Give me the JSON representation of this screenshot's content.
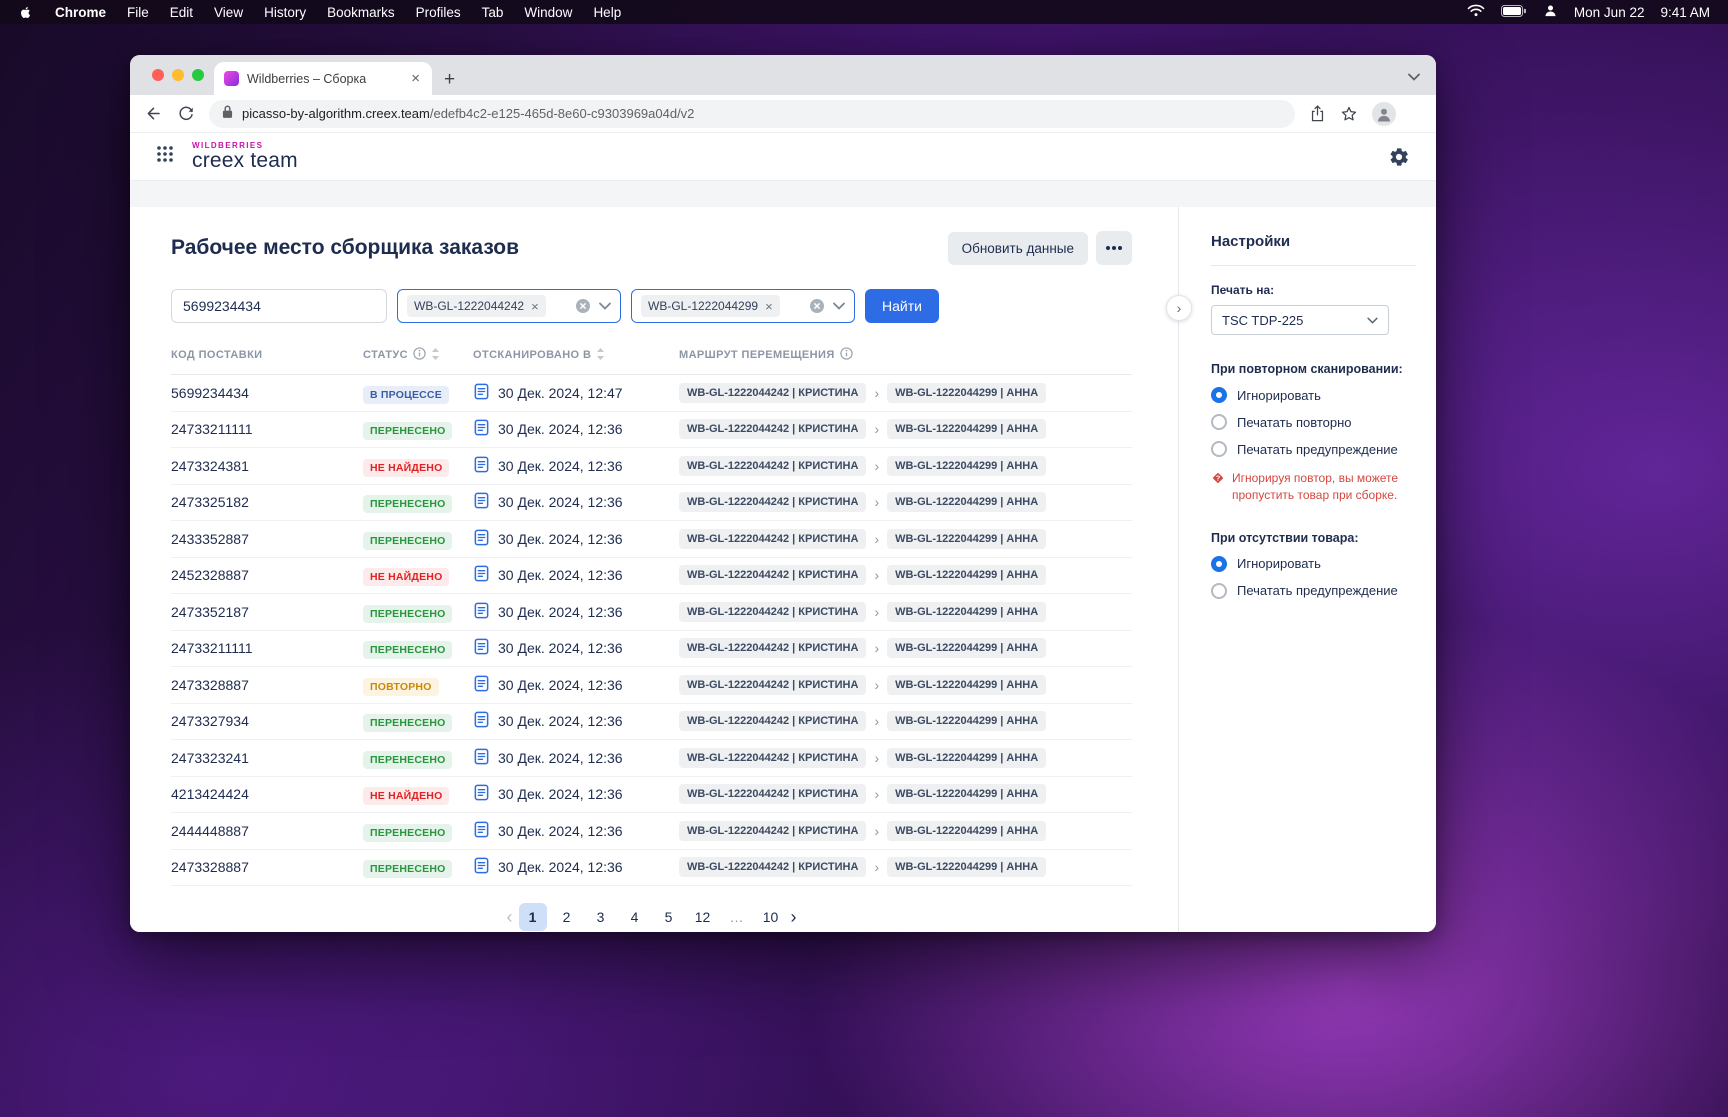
{
  "menubar": {
    "items": [
      "Chrome",
      "File",
      "Edit",
      "View",
      "History",
      "Bookmarks",
      "Profiles",
      "Tab",
      "Window",
      "Help"
    ],
    "date": "Mon Jun 22",
    "time": "9:41 AM"
  },
  "browser": {
    "tab_title": "Wildberries – Сборка",
    "new_tab": "+",
    "url_host": "picasso-by-algorithm.creex.team",
    "url_path": "/edefb4c2-e125-465d-8e60-c9303969a04d/v2"
  },
  "brand": {
    "top": "WILDBERRIES",
    "name": "creex team",
    "color": "#cb11ab"
  },
  "page": {
    "title": "Рабочее место сборщика заказов",
    "refresh_button": "Обновить данные",
    "find_button": "Найти",
    "search_value": "5699234434",
    "accent_color": "#2d6ce5"
  },
  "filters": [
    {
      "label": "WB-GL-1222044242"
    },
    {
      "label": "WB-GL-1222044299"
    }
  ],
  "table": {
    "headers": [
      "КОД ПОСТАВКИ",
      "СТАТУС",
      "ОТСКАНИРОВАНО В",
      "МАРШРУТ ПЕРЕМЕЩЕНИЯ"
    ],
    "status_colors": {
      "inprogress": {
        "bg": "#e8eef8",
        "fg": "#3b5bab"
      },
      "moved": {
        "bg": "#e5f3ea",
        "fg": "#27963c"
      },
      "notfound": {
        "bg": "#fdeaea",
        "fg": "#e02424"
      },
      "repeat": {
        "bg": "#fdf3e1",
        "fg": "#c98a0b"
      }
    },
    "rows": [
      {
        "code": "5699234434",
        "status": "В ПРОЦЕССЕ",
        "status_type": "inprogress",
        "scanned": "30 Дек. 2024, 12:47",
        "from": "WB-GL-1222044242 | КРИСТИНА",
        "to": "WB-GL-1222044299 | АННА"
      },
      {
        "code": "24733211111",
        "status": "ПЕРЕНЕСЕНО",
        "status_type": "moved",
        "scanned": "30 Дек. 2024, 12:36",
        "from": "WB-GL-1222044242 | КРИСТИНА",
        "to": "WB-GL-1222044299 | АННА"
      },
      {
        "code": "2473324381",
        "status": "НЕ НАЙДЕНО",
        "status_type": "notfound",
        "scanned": "30 Дек. 2024, 12:36",
        "from": "WB-GL-1222044242 | КРИСТИНА",
        "to": "WB-GL-1222044299 | АННА"
      },
      {
        "code": "2473325182",
        "status": "ПЕРЕНЕСЕНО",
        "status_type": "moved",
        "scanned": "30 Дек. 2024, 12:36",
        "from": "WB-GL-1222044242 | КРИСТИНА",
        "to": "WB-GL-1222044299 | АННА"
      },
      {
        "code": "2433352887",
        "status": "ПЕРЕНЕСЕНО",
        "status_type": "moved",
        "scanned": "30 Дек. 2024, 12:36",
        "from": "WB-GL-1222044242 | КРИСТИНА",
        "to": "WB-GL-1222044299 | АННА"
      },
      {
        "code": "2452328887",
        "status": "НЕ НАЙДЕНО",
        "status_type": "notfound",
        "scanned": "30 Дек. 2024, 12:36",
        "from": "WB-GL-1222044242 | КРИСТИНА",
        "to": "WB-GL-1222044299 | АННА"
      },
      {
        "code": "2473352187",
        "status": "ПЕРЕНЕСЕНО",
        "status_type": "moved",
        "scanned": "30 Дек. 2024, 12:36",
        "from": "WB-GL-1222044242 | КРИСТИНА",
        "to": "WB-GL-1222044299 | АННА"
      },
      {
        "code": "24733211111",
        "status": "ПЕРЕНЕСЕНО",
        "status_type": "moved",
        "scanned": "30 Дек. 2024, 12:36",
        "from": "WB-GL-1222044242 | КРИСТИНА",
        "to": "WB-GL-1222044299 | АННА"
      },
      {
        "code": "2473328887",
        "status": "ПОВТОРНО",
        "status_type": "repeat",
        "scanned": "30 Дек. 2024, 12:36",
        "from": "WB-GL-1222044242 | КРИСТИНА",
        "to": "WB-GL-1222044299 | АННА"
      },
      {
        "code": "2473327934",
        "status": "ПЕРЕНЕСЕНО",
        "status_type": "moved",
        "scanned": "30 Дек. 2024, 12:36",
        "from": "WB-GL-1222044242 | КРИСТИНА",
        "to": "WB-GL-1222044299 | АННА"
      },
      {
        "code": "2473323241",
        "status": "ПЕРЕНЕСЕНО",
        "status_type": "moved",
        "scanned": "30 Дек. 2024, 12:36",
        "from": "WB-GL-1222044242 | КРИСТИНА",
        "to": "WB-GL-1222044299 | АННА"
      },
      {
        "code": "4213424424",
        "status": "НЕ НАЙДЕНО",
        "status_type": "notfound",
        "scanned": "30 Дек. 2024, 12:36",
        "from": "WB-GL-1222044242 | КРИСТИНА",
        "to": "WB-GL-1222044299 | АННА"
      },
      {
        "code": "2444448887",
        "status": "ПЕРЕНЕСЕНО",
        "status_type": "moved",
        "scanned": "30 Дек. 2024, 12:36",
        "from": "WB-GL-1222044242 | КРИСТИНА",
        "to": "WB-GL-1222044299 | АННА"
      },
      {
        "code": "2473328887",
        "status": "ПЕРЕНЕСЕНО",
        "status_type": "moved",
        "scanned": "30 Дек. 2024, 12:36",
        "from": "WB-GL-1222044242 | КРИСТИНА",
        "to": "WB-GL-1222044299 | АННА"
      }
    ]
  },
  "pagination": {
    "prev": "‹",
    "next": "›",
    "pages": [
      "1",
      "2",
      "3",
      "4",
      "5",
      "12",
      "…",
      "10"
    ],
    "active": "1"
  },
  "settings": {
    "title": "Настройки",
    "print_label": "Печать на:",
    "printer": "TSC TDP-225",
    "rescan": {
      "label": "При повторном сканировании:",
      "options": [
        "Игнорировать",
        "Печатать повторно",
        "Печатать предупреждение"
      ],
      "selected_index": 0
    },
    "warning": "Игнорируя повтор, вы можете пропустить товар при сборке.",
    "warning_color": "#d5473f",
    "missing": {
      "label": "При отсутствии товара:",
      "options": [
        "Игнорировать",
        "Печатать предупреждение"
      ],
      "selected_index": 0
    }
  }
}
